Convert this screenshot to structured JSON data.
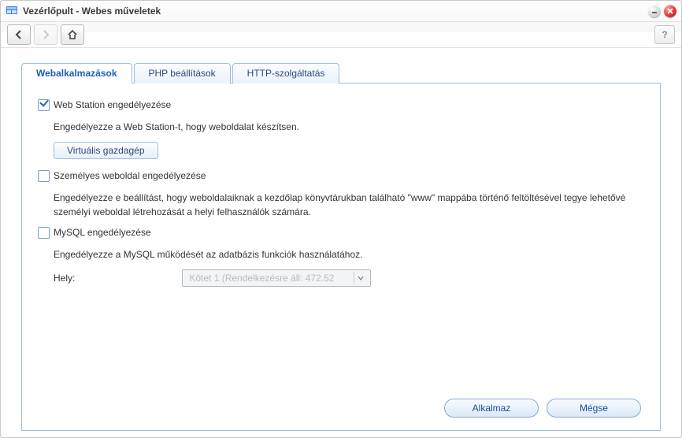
{
  "window": {
    "title": "Vezérlőpult - Webes műveletek"
  },
  "tabs": [
    {
      "label": "Webalkalmazások",
      "active": true
    },
    {
      "label": "PHP beállítások",
      "active": false
    },
    {
      "label": "HTTP-szolgáltatás",
      "active": false
    }
  ],
  "form": {
    "webstation": {
      "checked": true,
      "label": "Web Station engedélyezése",
      "desc": "Engedélyezze a Web Station-t, hogy weboldalat készítsen.",
      "button": "Virtuális gazdagép"
    },
    "personal": {
      "checked": false,
      "label": "Személyes weboldal engedélyezése",
      "desc": "Engedélyezze e beállítást, hogy weboldalaiknak a kezdőlap könyvtárukban található \"www\" mappába történő feltöltésével tegye lehetővé személyi weboldal létrehozását a helyi felhasználók számára."
    },
    "mysql": {
      "checked": false,
      "label": "MySQL engedélyezése",
      "desc": "Engedélyezze a MySQL működését az adatbázis funkciók használatához.",
      "location_label": "Hely:",
      "location_value": "Kötet 1 (Rendelkezésre áll: 472.52",
      "location_disabled": true
    }
  },
  "footer": {
    "apply": "Alkalmaz",
    "cancel": "Mégse"
  },
  "help_label": "?"
}
